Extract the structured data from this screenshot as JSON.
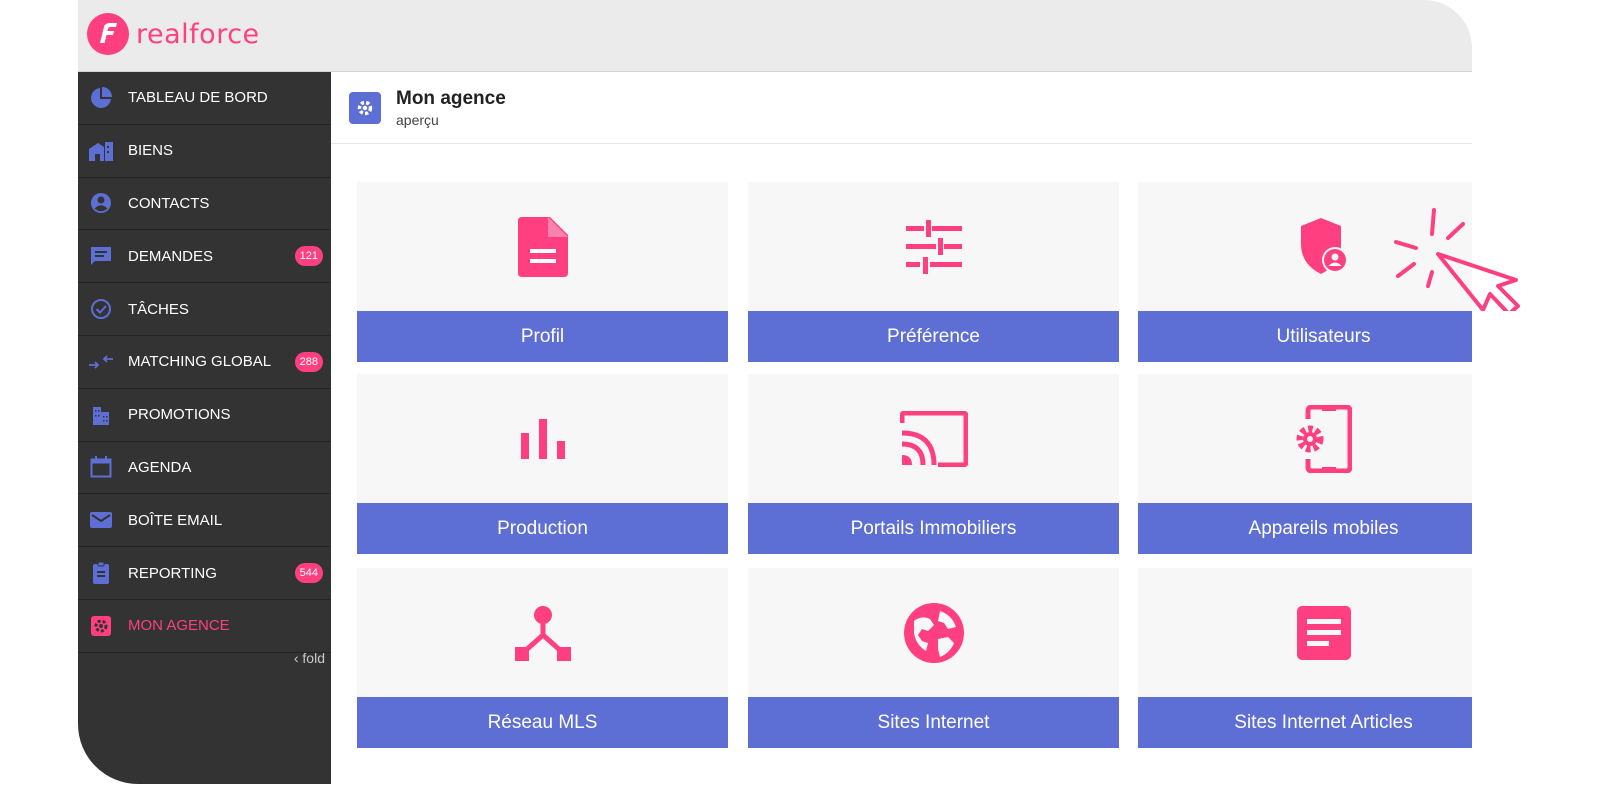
{
  "app": {
    "brand": "realforce",
    "colors": {
      "accent": "#ff3f80",
      "primary": "#5d6fd5",
      "sidebar_bg": "#333333"
    }
  },
  "sidebar": {
    "items": [
      {
        "label": "TABLEAU DE BORD",
        "icon": "dashboard-pie-icon"
      },
      {
        "label": "BIENS",
        "icon": "house-icon"
      },
      {
        "label": "CONTACTS",
        "icon": "contact-icon"
      },
      {
        "label": "DEMANDES",
        "icon": "message-icon",
        "badge": "121"
      },
      {
        "label": "TÂCHES",
        "icon": "check-circle-icon"
      },
      {
        "label": "MATCHING GLOBAL",
        "icon": "swap-arrows-icon",
        "badge": "288"
      },
      {
        "label": "PROMOTIONS",
        "icon": "building-icon"
      },
      {
        "label": "AGENDA",
        "icon": "calendar-icon"
      },
      {
        "label": "BOÎTE EMAIL",
        "icon": "mail-icon"
      },
      {
        "label": "REPORTING",
        "icon": "clipboard-icon",
        "badge": "544"
      },
      {
        "label": "MON AGENCE",
        "icon": "gear-icon",
        "active": true
      }
    ],
    "fold_label": "fold"
  },
  "header": {
    "title": "Mon agence",
    "subtitle": "aperçu",
    "icon": "gear-icon"
  },
  "tiles": [
    {
      "label": "Profil",
      "icon": "document-icon"
    },
    {
      "label": "Préférence",
      "icon": "sliders-icon"
    },
    {
      "label": "Utilisateurs",
      "icon": "shield-user-icon"
    },
    {
      "label": "Production",
      "icon": "bar-chart-icon"
    },
    {
      "label": "Portails Immobiliers",
      "icon": "cast-icon"
    },
    {
      "label": "Appareils mobiles",
      "icon": "mobile-settings-icon"
    },
    {
      "label": "Réseau MLS",
      "icon": "network-icon"
    },
    {
      "label": "Sites Internet",
      "icon": "globe-icon"
    },
    {
      "label": "Sites Internet Articles",
      "icon": "article-icon"
    }
  ]
}
